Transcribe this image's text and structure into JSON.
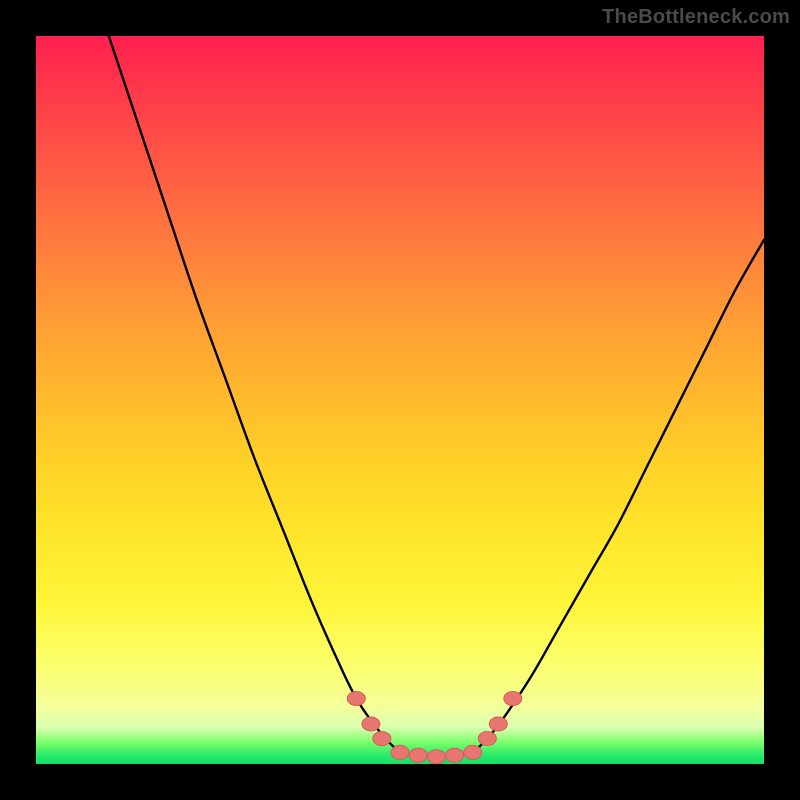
{
  "watermark": {
    "text": "TheBottleneck.com"
  },
  "colors": {
    "frame": "#000000",
    "curve": "#000000",
    "marker_fill": "#e6766f",
    "marker_stroke": "#d65d57",
    "gradient_top": "#ff1f4f",
    "gradient_bottom": "#18dd68"
  },
  "chart_data": {
    "type": "line",
    "title": "",
    "xlabel": "",
    "ylabel": "",
    "xlim": [
      0,
      100
    ],
    "ylim": [
      0,
      100
    ],
    "grid": false,
    "series": [
      {
        "name": "left-curve",
        "x": [
          10,
          14,
          18,
          22,
          26,
          30,
          34,
          38,
          42,
          44,
          46,
          48,
          49.5
        ],
        "y": [
          100,
          88,
          76,
          64,
          53,
          42,
          32,
          22,
          13,
          9,
          6,
          3.5,
          2
        ]
      },
      {
        "name": "floor",
        "x": [
          49.5,
          51,
          53,
          55,
          57,
          59,
          60.5
        ],
        "y": [
          2,
          1.4,
          1.1,
          1.0,
          1.1,
          1.4,
          2
        ]
      },
      {
        "name": "right-curve",
        "x": [
          60.5,
          62,
          64,
          68,
          72,
          76,
          80,
          84,
          88,
          92,
          96,
          100
        ],
        "y": [
          2,
          3.5,
          6,
          12,
          19,
          26,
          33,
          41,
          49,
          57,
          65,
          72
        ]
      }
    ],
    "markers": {
      "name": "bottom-cluster",
      "points": [
        {
          "x": 44.0,
          "y": 9.0
        },
        {
          "x": 46.0,
          "y": 5.5
        },
        {
          "x": 47.5,
          "y": 3.5
        },
        {
          "x": 50.0,
          "y": 1.6
        },
        {
          "x": 52.5,
          "y": 1.2
        },
        {
          "x": 55.0,
          "y": 1.0
        },
        {
          "x": 57.5,
          "y": 1.2
        },
        {
          "x": 60.0,
          "y": 1.6
        },
        {
          "x": 62.0,
          "y": 3.5
        },
        {
          "x": 63.5,
          "y": 5.5
        },
        {
          "x": 65.5,
          "y": 9.0
        }
      ]
    }
  }
}
